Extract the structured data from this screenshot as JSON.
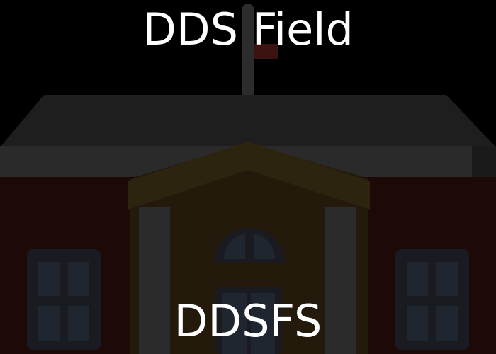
{
  "image": {
    "subject": "school-building-icon",
    "caption_top": "DDS Field",
    "caption_bottom": "DDSFS"
  },
  "colors": {
    "background": "#000000",
    "roof": "#1e1e1e",
    "eave": "#2a2a2a",
    "wall": "#1d0a08",
    "center_wall": "#241a0c",
    "trim": "#2d2410",
    "window_frame": "#191b20",
    "window_pane": "#1f2630",
    "flag": "#3a1210",
    "pole": "#2c2c2c",
    "text": "#ffffff"
  }
}
